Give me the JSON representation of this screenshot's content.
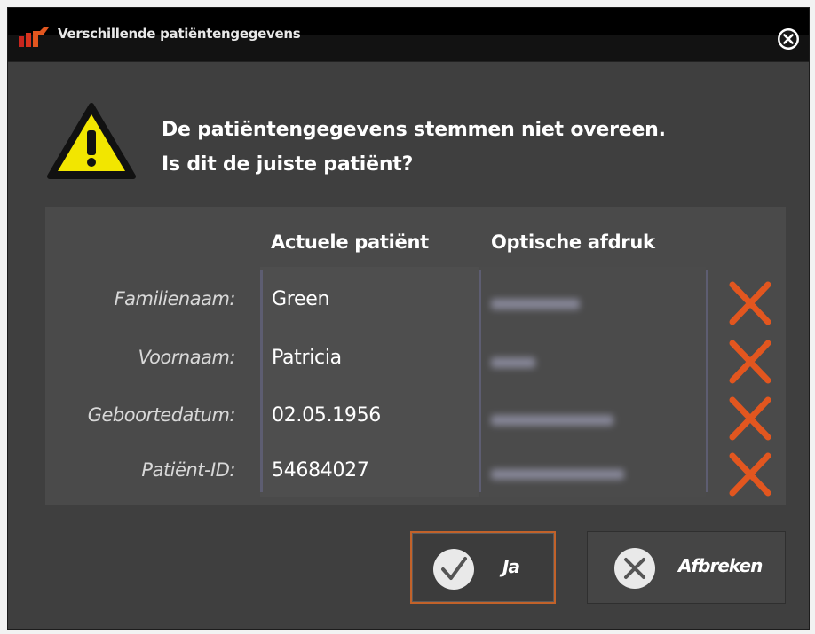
{
  "window": {
    "title": "Verschillende patiëntengegevens"
  },
  "message": {
    "line1": "De patiëntengegevens stemmen niet overeen.",
    "line2": "Is dit de juiste patiënt?"
  },
  "table": {
    "headers": {
      "current": "Actuele patiënt",
      "optical": "Optische afdruk"
    },
    "rows": [
      {
        "label": "Familienaam:",
        "current": "Green",
        "match": false
      },
      {
        "label": "Voornaam:",
        "current": "Patricia",
        "match": false
      },
      {
        "label": "Geboortedatum:",
        "current": "02.05.1956",
        "match": false
      },
      {
        "label": "Patiënt-ID:",
        "current": "54684027",
        "match": false
      }
    ]
  },
  "buttons": {
    "yes_label": "Ja",
    "cancel_label": "Afbreken"
  },
  "icons": {
    "app": "app-logo-icon",
    "close": "close-circle-icon",
    "warning": "warning-triangle-icon",
    "mismatch": "x-mark-icon",
    "check": "check-circle-icon",
    "cancel": "x-circle-icon"
  },
  "colors": {
    "background": "#3f3f3f",
    "accent": "#e2561f",
    "warning_yellow": "#f2e600",
    "focus_border": "#c2622a",
    "text": "#ffffff",
    "label_text": "#d8d8d8"
  }
}
